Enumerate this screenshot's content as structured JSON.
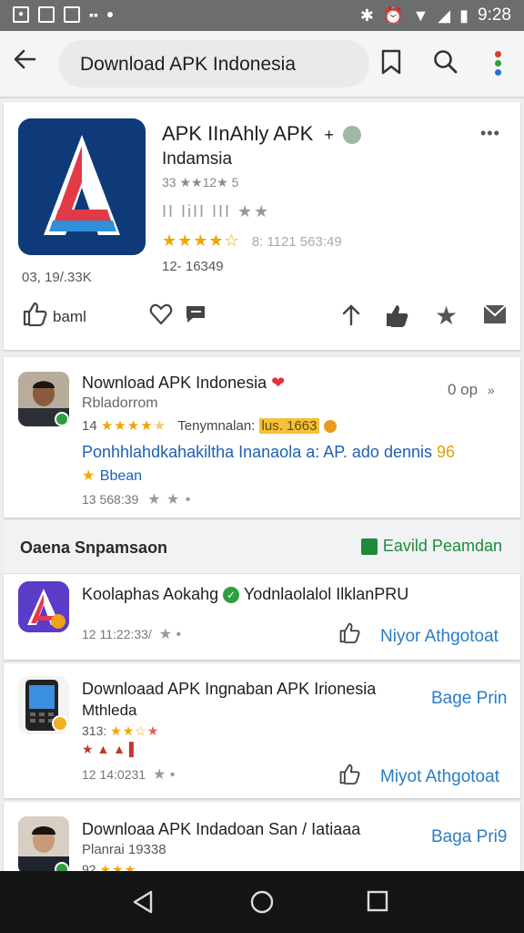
{
  "status_bar": {
    "time": "9:28"
  },
  "app_bar": {
    "search_text": "Download APK Indonesia"
  },
  "main_app": {
    "title": "APK IInAhly APK",
    "title_mark": "+",
    "subtitle": "Indamsia",
    "meta1": "33 ★★12★ 5",
    "meta2": "II IiII III ★★",
    "rating_stars": "★★★★☆",
    "rating_text": "8: 1121  563:49",
    "count": "12- 16349",
    "downloads": "03, 19/.33K",
    "like_label": "baml",
    "more": "•••"
  },
  "review": {
    "title": "Nownload APK Indonesia",
    "subtitle": "Rbladorrom",
    "right_meta": "0 op",
    "right_arrow": "»",
    "rating_num": "14",
    "rating_stars": "★★★★",
    "rating_half": "★",
    "tag_text": "Tenymnalan:",
    "tag_highlight": "lus. 1663",
    "body_link": "Ponhhlahdkahakiltha Inanaola a: AP. ado dennis",
    "body_num": "96",
    "body_star": "★",
    "body_extra": "Bbean",
    "footer_num": "13 568:39",
    "footer_stars": "★ ★ •"
  },
  "section": {
    "title": "Oaena Snpamsaon",
    "action": "Eavild Peamdan"
  },
  "items": [
    {
      "title": "Koolaphas Aokahg",
      "title_extra": "Yodnlaolalol IlklanPRU",
      "meta": "12  11:22:33/",
      "meta_stars": "★ •",
      "action": "Niyor Athgotoat"
    },
    {
      "title": "Downloaad APK Ingnaban  APK Irionesia",
      "subtitle": "Mthleda",
      "rating": "313:",
      "rating_stars": "★★☆",
      "rating_tail": "★",
      "icons_row": "★ ▲ ▲ ▌",
      "meta": "12  14:0231",
      "meta_stars": "★ •",
      "action": "Miyot Athgotoat",
      "right_link": "Bage Prin"
    },
    {
      "title": "Downloaa APK Indadoan San / Iatiaaa",
      "subtitle": "Planrai 19338",
      "rating": "92",
      "rating_stars": "★★★",
      "right_link": "Baga Pri9"
    }
  ],
  "colors": {
    "accent_blue": "#2b7cc4",
    "link_blue": "#1e5fb5",
    "star_yellow": "#f2a400",
    "green": "#2e9e3f",
    "nav_bar": "#141414"
  }
}
